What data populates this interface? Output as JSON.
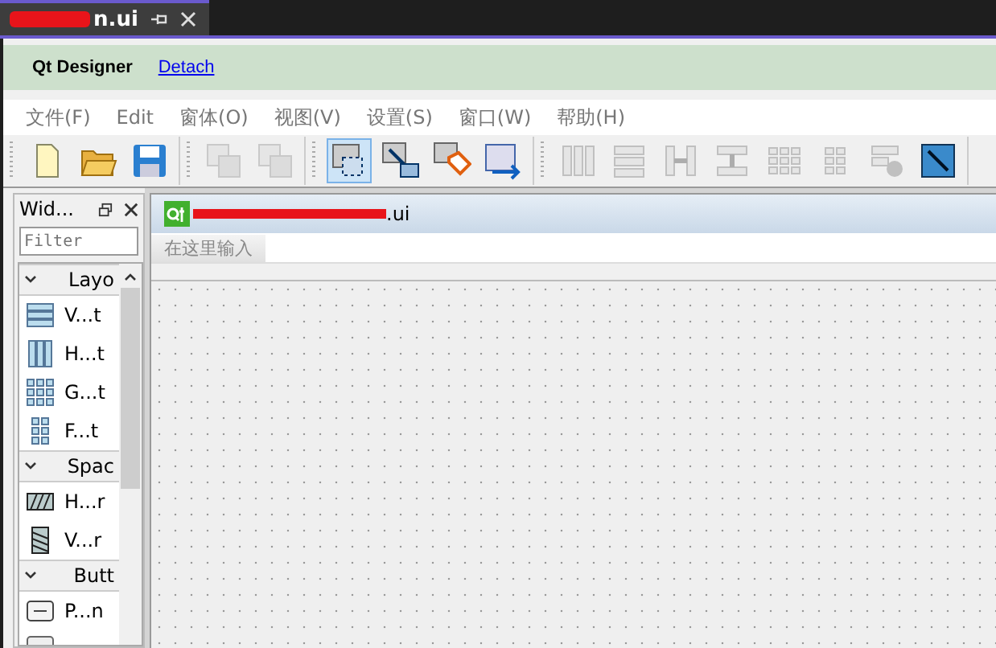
{
  "tab": {
    "title": "n.ui"
  },
  "banner": {
    "title": "Qt Designer",
    "link": "Detach"
  },
  "menu": [
    "文件(F)",
    "Edit",
    "窗体(O)",
    "视图(V)",
    "设置(S)",
    "窗口(W)",
    "帮助(H)"
  ],
  "toolbar": [
    [
      {
        "kind": "new",
        "disabled": false,
        "selected": false
      },
      {
        "kind": "open",
        "disabled": false,
        "selected": false
      },
      {
        "kind": "save",
        "disabled": false,
        "selected": false
      }
    ],
    [
      {
        "kind": "front",
        "disabled": true,
        "selected": false
      },
      {
        "kind": "back",
        "disabled": true,
        "selected": false
      }
    ],
    [
      {
        "kind": "widgets",
        "disabled": false,
        "selected": true
      },
      {
        "kind": "signals",
        "disabled": false,
        "selected": false
      },
      {
        "kind": "buddies",
        "disabled": false,
        "selected": false
      },
      {
        "kind": "taborder",
        "disabled": false,
        "selected": false
      }
    ],
    [
      {
        "kind": "hlayout",
        "disabled": true,
        "selected": false
      },
      {
        "kind": "vlayout",
        "disabled": true,
        "selected": false
      },
      {
        "kind": "hsplit",
        "disabled": true,
        "selected": false
      },
      {
        "kind": "vsplit",
        "disabled": true,
        "selected": false
      },
      {
        "kind": "grid",
        "disabled": true,
        "selected": false
      },
      {
        "kind": "form",
        "disabled": true,
        "selected": false
      },
      {
        "kind": "break",
        "disabled": true,
        "selected": false
      },
      {
        "kind": "adjust",
        "disabled": false,
        "selected": false
      }
    ]
  ],
  "widget_box": {
    "title": "Wid...",
    "filter": {
      "placeholder": "Filter"
    },
    "categories": [
      {
        "name": "Layo",
        "expanded": true,
        "items": [
          {
            "kind": "vlayout",
            "label": "V...t"
          },
          {
            "kind": "hlayout",
            "label": "H...t"
          },
          {
            "kind": "grid",
            "label": "G...t"
          },
          {
            "kind": "form",
            "label": "F...t"
          }
        ]
      },
      {
        "name": "Spac",
        "expanded": true,
        "items": [
          {
            "kind": "hspacer",
            "label": "H...r"
          },
          {
            "kind": "vspacer",
            "label": "V...r"
          }
        ]
      },
      {
        "name": "Butt",
        "expanded": true,
        "items": [
          {
            "kind": "pushbutton",
            "label": "P...n"
          },
          {
            "kind": "toolbutton"
          }
        ]
      }
    ]
  },
  "form": {
    "title": ".ui",
    "menu_placeholder": "在这里输入"
  }
}
